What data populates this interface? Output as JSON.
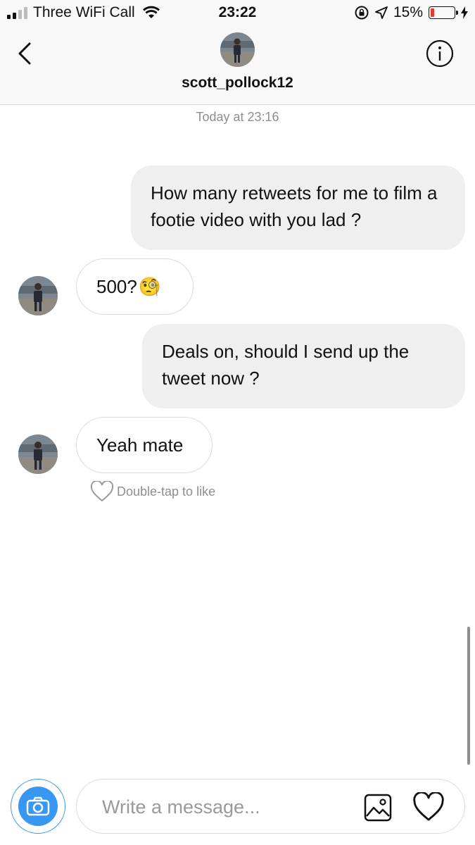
{
  "status_bar": {
    "carrier": "Three WiFi Call",
    "time": "23:22",
    "battery_percent": "15%",
    "battery_level": 0.15,
    "icons": [
      "signal-icon",
      "wifi-icon",
      "orientation-lock-icon",
      "location-icon",
      "battery-icon",
      "charging-icon"
    ]
  },
  "header": {
    "username": "scott_pollock12",
    "icons": [
      "back-icon",
      "info-icon"
    ]
  },
  "conversation": {
    "timestamp": "Today at 23:16",
    "messages": [
      {
        "sender": "me",
        "text": "How many retweets for me to film a footie video with you lad ?"
      },
      {
        "sender": "them",
        "text": "500?",
        "emoji": "🧐"
      },
      {
        "sender": "me",
        "text": "Deals on, should I send up the tweet now ?"
      },
      {
        "sender": "them",
        "text": "Yeah mate"
      }
    ],
    "like_hint": "Double-tap to like"
  },
  "composer": {
    "placeholder": "Write a message...",
    "value": "",
    "icons": [
      "camera-icon",
      "gallery-icon",
      "heart-icon"
    ]
  },
  "colors": {
    "accent": "#3897f0",
    "bubble_out": "#efefef",
    "muted_text": "#8e8e8e",
    "battery_low": "#e53935"
  }
}
